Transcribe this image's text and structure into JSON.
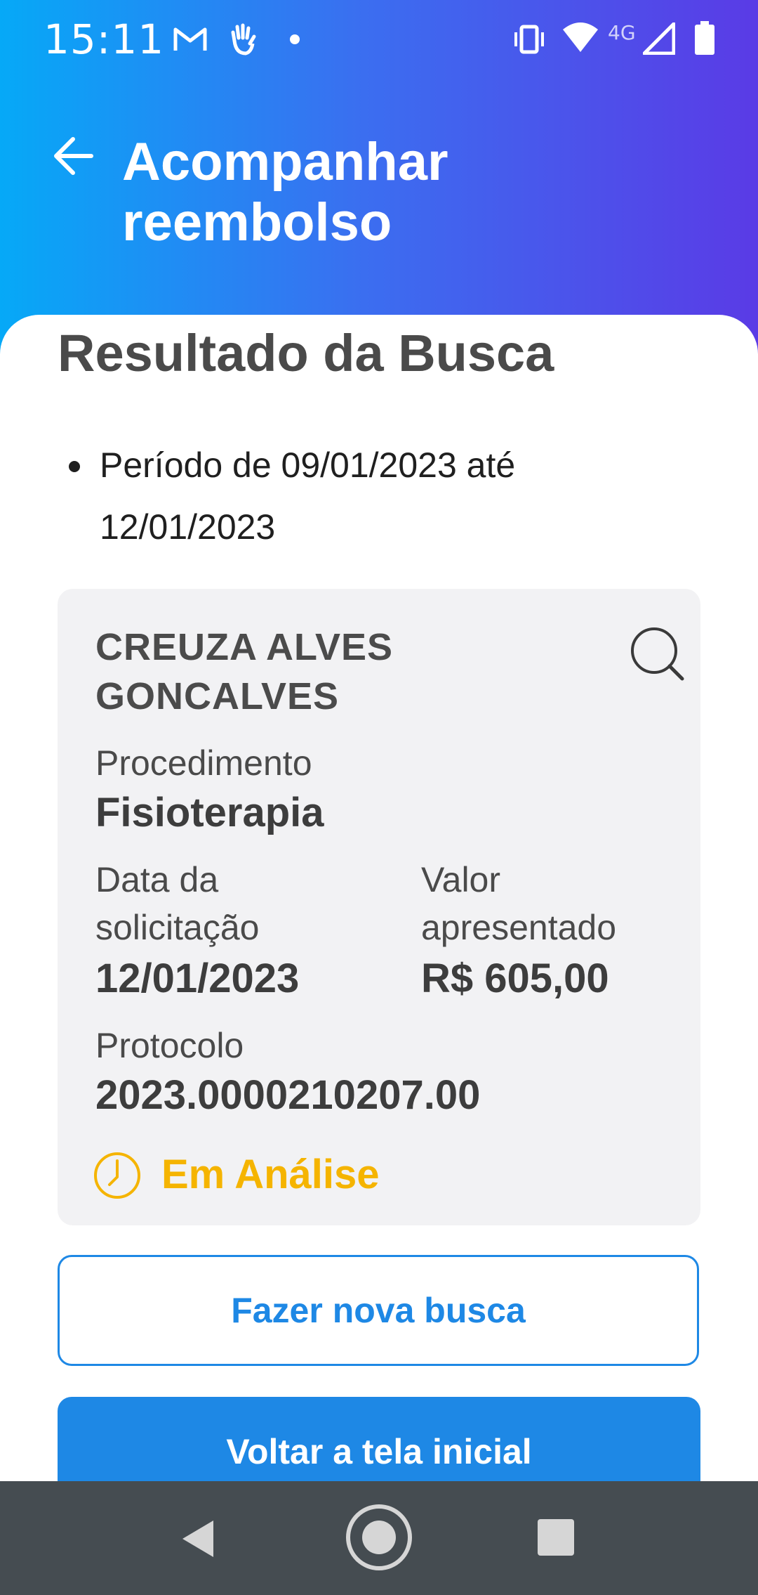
{
  "status_bar": {
    "time": "15:11",
    "network_label": "4G",
    "icons": [
      "gmail-icon",
      "hand-icon",
      "notification-dot",
      "vibrate-icon",
      "wifi-icon",
      "signal-icon",
      "battery-icon"
    ]
  },
  "header": {
    "title": "Acompanhar reembolso",
    "back_icon": "arrow-left-icon"
  },
  "main": {
    "section_title": "Resultado da Busca",
    "period": "Período de 09/01/2023 até 12/01/2023",
    "card": {
      "beneficiary": "CREUZA ALVES GONCALVES",
      "procedure_label": "Procedimento",
      "procedure_value": "Fisioterapia",
      "request_date_label": "Data da solicitação",
      "request_date_value": "12/01/2023",
      "amount_label": "Valor apresentado",
      "amount_value": "R$ 605,00",
      "protocol_label": "Protocolo",
      "protocol_value": "2023.0000210207.00",
      "status": "Em Análise",
      "status_color": "#f5b400",
      "search_icon": "search-icon"
    },
    "buttons": {
      "new_search": "Fazer nova busca",
      "back_home": "Voltar a tela inicial"
    }
  },
  "colors": {
    "header_gradient_start": "#06a9f7",
    "header_gradient_end": "#5a3be6",
    "accent": "#1e88e5",
    "card_bg": "#f2f2f4",
    "nav_bar": "#454c51"
  },
  "nav_bar": {
    "icons": [
      "nav-back-icon",
      "nav-home-icon",
      "nav-recents-icon"
    ]
  }
}
